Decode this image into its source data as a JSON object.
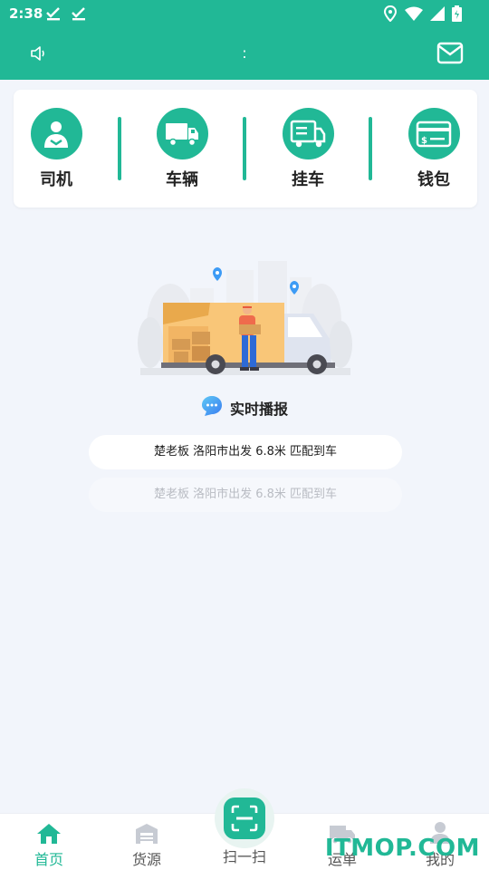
{
  "status_bar": {
    "time": "2:38"
  },
  "app_bar": {
    "title": ":"
  },
  "quick_actions": [
    {
      "label": "司机",
      "icon": "driver-icon"
    },
    {
      "label": "车辆",
      "icon": "truck-icon"
    },
    {
      "label": "挂车",
      "icon": "trailer-icon"
    },
    {
      "label": "钱包",
      "icon": "wallet-icon"
    }
  ],
  "broadcast": {
    "title": "实时播报",
    "items": [
      "楚老板 洛阳市出发 6.8米 匹配到车",
      "楚老板 洛阳市出发 6.8米 匹配到车"
    ]
  },
  "bottom_nav": {
    "home": "首页",
    "cargo": "货源",
    "scan": "扫一扫",
    "waybill": "运单",
    "mine": "我的",
    "active": "home"
  },
  "watermark": "ITMOP.COM",
  "colors": {
    "accent": "#21b896",
    "background": "#f2f5fb"
  }
}
